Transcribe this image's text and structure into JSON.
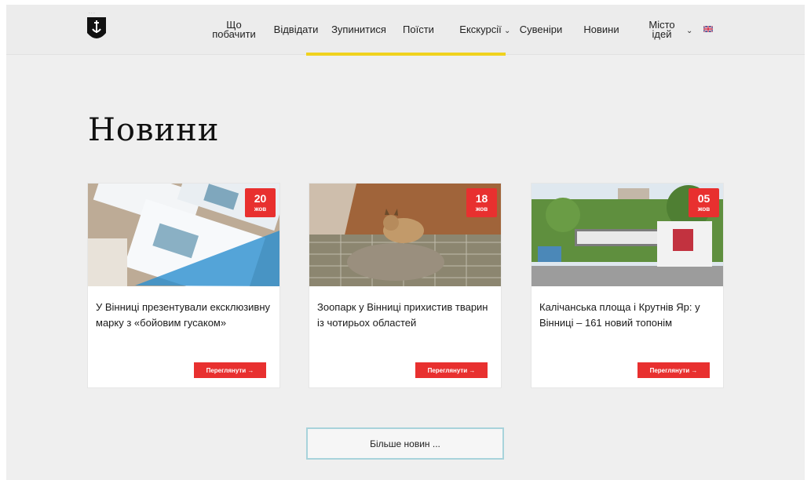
{
  "nav": {
    "items": [
      {
        "label": "Що\nпобачити"
      },
      {
        "label": "Відвідати"
      },
      {
        "label": "Зупинитися"
      },
      {
        "label": "Поїсти"
      },
      {
        "label": "Екскурсії"
      },
      {
        "label": "Сувеніри"
      },
      {
        "label": "Новини"
      },
      {
        "label": "Місто\nідей"
      }
    ],
    "language_icon": "uk-flag-icon",
    "active_color": "#f0d21e"
  },
  "page": {
    "title": "Новини"
  },
  "news": [
    {
      "day": "20",
      "month": "жов",
      "title": "У Вінниці презентували ексклюзивну марку з «бойовим гусаком»",
      "button": "Переглянути →"
    },
    {
      "day": "18",
      "month": "жов",
      "title": "Зоопарк у Вінниці прихистив тварин із чотирьох областей",
      "button": "Переглянути →"
    },
    {
      "day": "05",
      "month": "жов",
      "title": "Калічанська площа і Крутнів Яр: у Вінниці – 161 новий топонім",
      "button": "Переглянути →"
    }
  ],
  "more_button": "Більше новин ...",
  "colors": {
    "accent": "#e8302f",
    "more_border": "#a8d3db"
  }
}
